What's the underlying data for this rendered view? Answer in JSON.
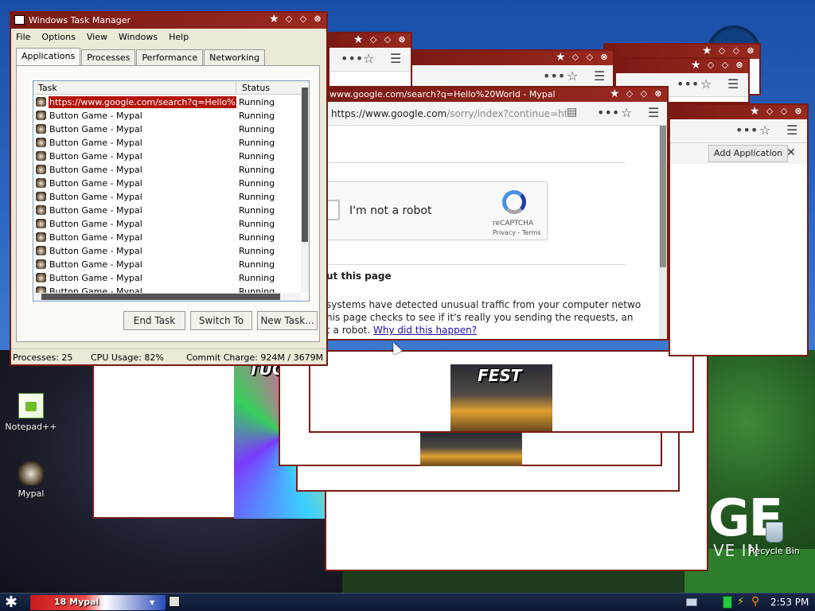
{
  "desktop": {
    "banner_big": "GE",
    "banner_small": "VE IN",
    "icons": [
      {
        "label": "Notepad++"
      },
      {
        "label": "Mypal"
      },
      {
        "label": "Recycle Bin"
      }
    ]
  },
  "back_images": {
    "caption_fest": "FEST",
    "caption_tuc": "TUC"
  },
  "mypal": {
    "title": "www.google.com/search?q=Hello%20World - Mypal",
    "url_host": "https://www.google.com",
    "url_rest": "/sorry/index?continue=ht",
    "captcha_label": "I'm not a robot",
    "captcha_brand": "reCAPTCHA",
    "captcha_links": "Privacy - Terms",
    "about_heading": "ut this page",
    "para_line1": "systems have detected unusual traffic from your computer netwo",
    "para_line2": "his page checks to see if it's really you sending the requests, an",
    "para_line3_prefix": "t a robot.",
    "para_link": "Why did this happen?"
  },
  "back_window": {
    "add_app": "Add Application",
    "close": "✕"
  },
  "taskmanager": {
    "title": "Windows Task Manager",
    "menu": [
      "File",
      "Options",
      "View",
      "Windows",
      "Help"
    ],
    "tabs": [
      "Applications",
      "Processes",
      "Performance",
      "Networking"
    ],
    "active_tab": "Applications",
    "columns": {
      "task": "Task",
      "status": "Status"
    },
    "rows": [
      {
        "task": "https://www.google.com/search?q=Hello%2...",
        "status": "Running",
        "selected": true
      },
      {
        "task": "Button Game - Mypal",
        "status": "Running"
      },
      {
        "task": "Button Game - Mypal",
        "status": "Running"
      },
      {
        "task": "Button Game - Mypal",
        "status": "Running"
      },
      {
        "task": "Button Game - Mypal",
        "status": "Running"
      },
      {
        "task": "Button Game - Mypal",
        "status": "Running"
      },
      {
        "task": "Button Game - Mypal",
        "status": "Running"
      },
      {
        "task": "Button Game - Mypal",
        "status": "Running"
      },
      {
        "task": "Button Game - Mypal",
        "status": "Running"
      },
      {
        "task": "Button Game - Mypal",
        "status": "Running"
      },
      {
        "task": "Button Game - Mypal",
        "status": "Running"
      },
      {
        "task": "Button Game - Mypal",
        "status": "Running"
      },
      {
        "task": "Button Game - Mypal",
        "status": "Running"
      },
      {
        "task": "Button Game - Mypal",
        "status": "Running"
      },
      {
        "task": "Button Game - Mypal",
        "status": "Running"
      },
      {
        "task": "Button Game - Mypal",
        "status": "Running"
      }
    ],
    "buttons": {
      "end_task": "End Task",
      "switch_to": "Switch To",
      "new_task": "New Task..."
    },
    "status": {
      "processes": "Processes: 25",
      "cpu": "CPU Usage: 82%",
      "commit": "Commit Charge: 924M / 3679M"
    }
  },
  "taskbar": {
    "group_label": "18 Mypal",
    "clock": "2:53 PM"
  }
}
